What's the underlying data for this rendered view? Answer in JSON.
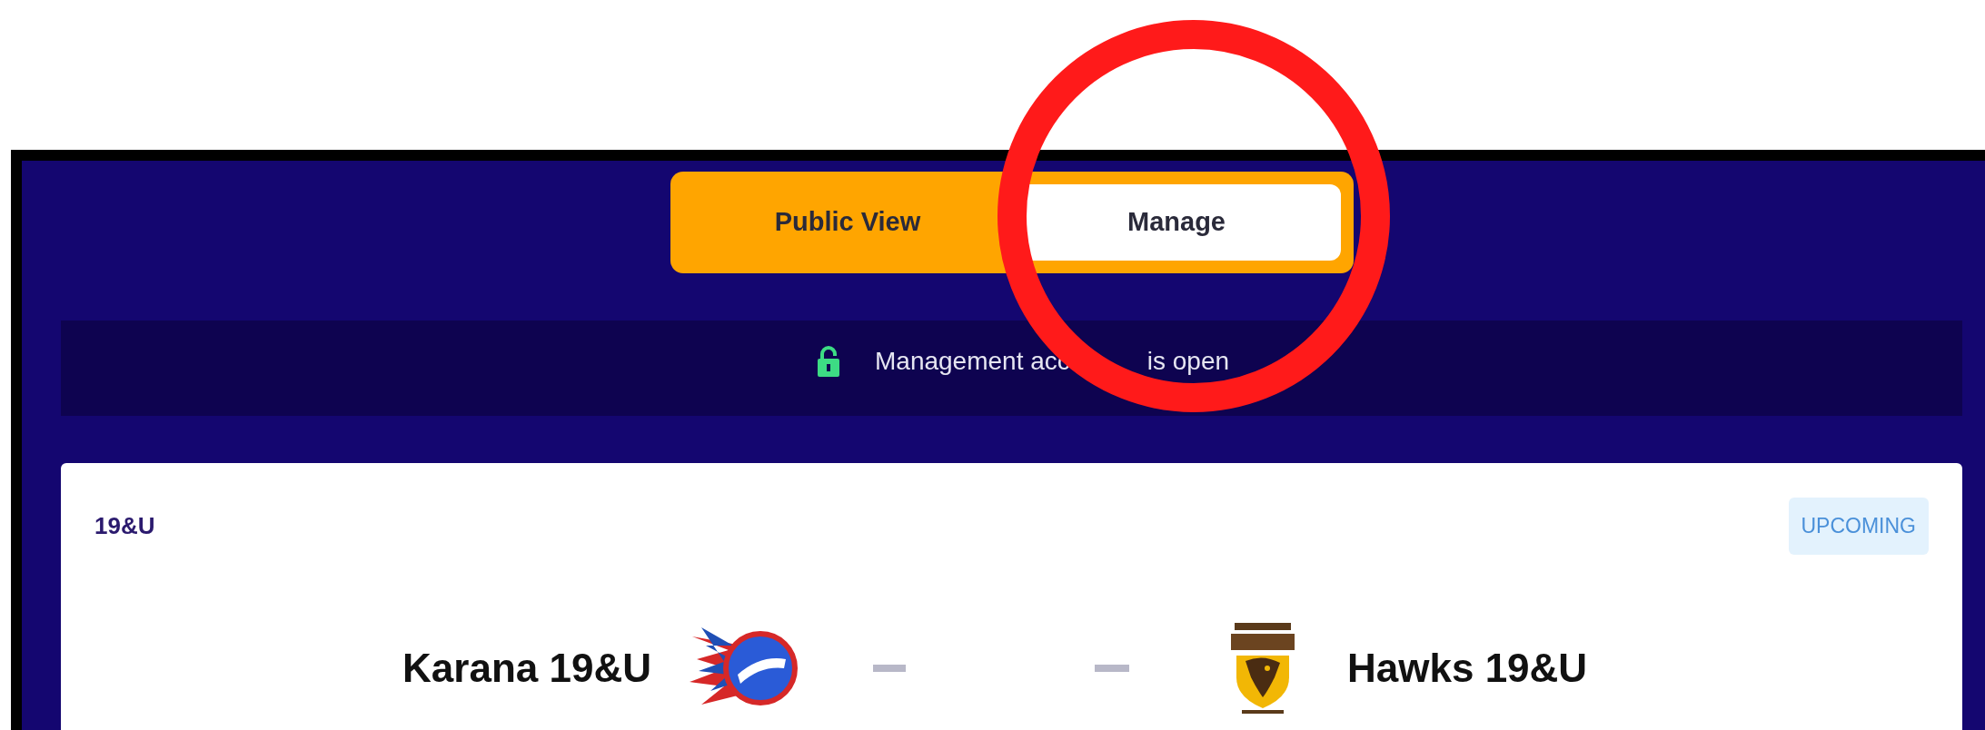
{
  "view_toggle": [
    {
      "label": "Public View",
      "selected": false
    },
    {
      "label": "Manage",
      "selected": true
    }
  ],
  "access_banner": {
    "locked": false,
    "text_parts": [
      "Management acc",
      "is open"
    ]
  },
  "match": {
    "division": "19&U",
    "status": "UPCOMING",
    "home_team": "Karana 19&U",
    "away_team": "Hawks 19&U"
  }
}
